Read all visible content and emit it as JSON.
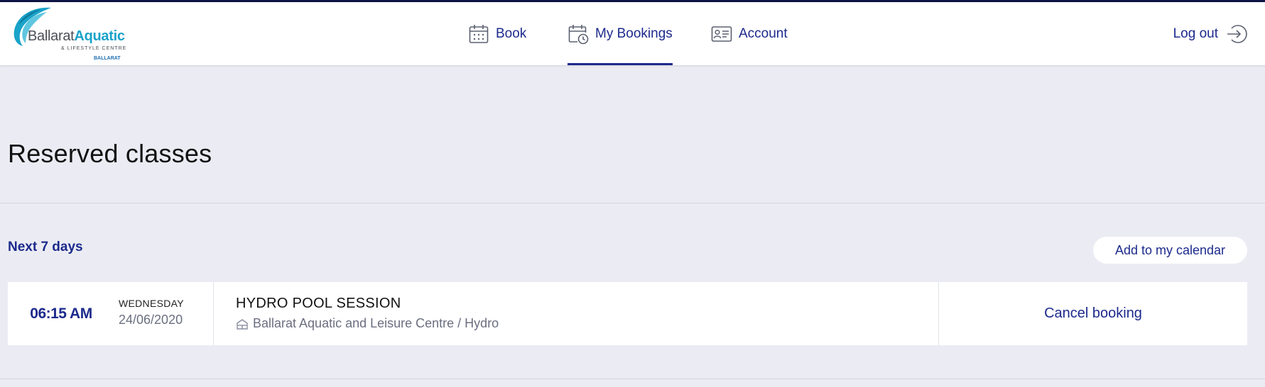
{
  "logo": {
    "line1": "Ballarat",
    "line2": "Aquatic",
    "subline": "& LIFESTYLE CENTRE",
    "city": "BALLARAT"
  },
  "nav": {
    "items": [
      {
        "label": "Book",
        "icon": "calendar-icon",
        "active": false
      },
      {
        "label": "My Bookings",
        "icon": "calendar-clock-icon",
        "active": true
      },
      {
        "label": "Account",
        "icon": "id-card-icon",
        "active": false
      }
    ],
    "logout_label": "Log out",
    "logout_icon": "logout-arrow-icon"
  },
  "page": {
    "title": "Reserved classes"
  },
  "section": {
    "label": "Next 7 days",
    "calendar_button": "Add to my calendar"
  },
  "booking": {
    "time": "06:15 AM",
    "weekday": "WEDNESDAY",
    "date": "24/06/2020",
    "class_name": "HYDRO POOL SESSION",
    "location": "Ballarat Aquatic and Leisure Centre / Hydro",
    "location_icon": "building-icon",
    "cancel_label": "Cancel booking"
  },
  "colors": {
    "accent": "#1c2a8c",
    "background": "#ebecf3",
    "logo_teal": "#1aa3c9",
    "top_strip": "#0e1445"
  }
}
